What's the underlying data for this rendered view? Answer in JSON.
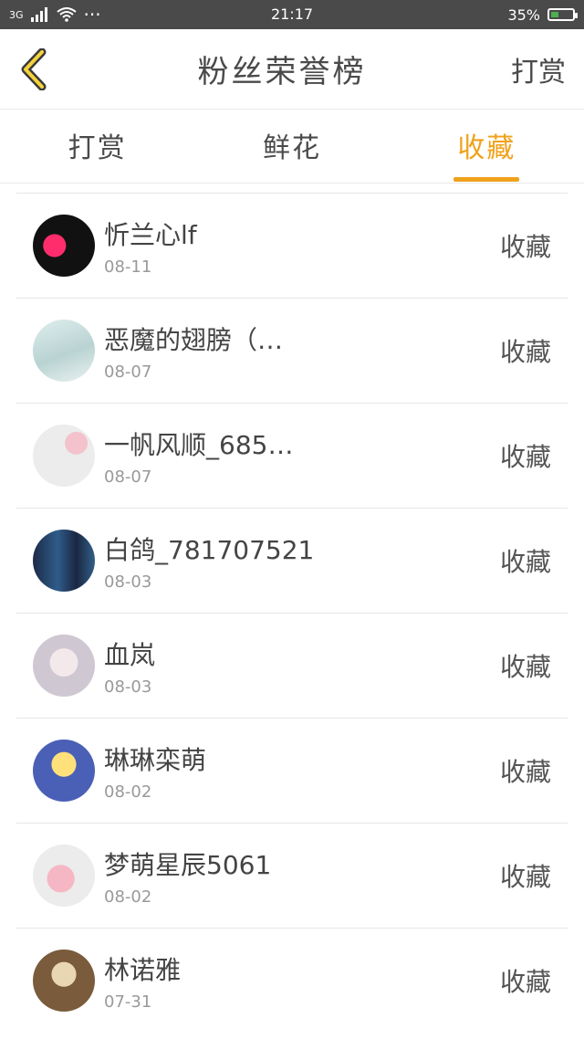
{
  "status_bar": {
    "network": "3G",
    "time": "21:17",
    "battery": "35%",
    "battery_level": 0.35,
    "dots": "···"
  },
  "header": {
    "title": "粉丝荣誉榜",
    "action": "打赏"
  },
  "tabs": [
    {
      "label": "打赏",
      "active": false
    },
    {
      "label": "鲜花",
      "active": false
    },
    {
      "label": "收藏",
      "active": true
    }
  ],
  "colors": {
    "accent": "#f0a21b",
    "status_bar": "#4a4a4a"
  },
  "list": [
    {
      "name": "忻兰心lf",
      "date": "08-11",
      "action": "收藏",
      "avatar": "heart-avatar"
    },
    {
      "name": "恶魔的翅膀（…",
      "date": "08-07",
      "action": "收藏",
      "avatar": "girl-white-avatar"
    },
    {
      "name": "一帆风顺_685…",
      "date": "08-07",
      "action": "收藏",
      "avatar": "plum-blossom-avatar"
    },
    {
      "name": "白鸽_781707521",
      "date": "08-03",
      "action": "收藏",
      "avatar": "group-photo-avatar"
    },
    {
      "name": "血岚",
      "date": "08-03",
      "action": "收藏",
      "avatar": "anime-girl-avatar"
    },
    {
      "name": "琳琳栾萌",
      "date": "08-02",
      "action": "收藏",
      "avatar": "fairy-avatar"
    },
    {
      "name": "梦萌星辰5061",
      "date": "08-02",
      "action": "收藏",
      "avatar": "pink-rabbit-avatar"
    },
    {
      "name": "林诺雅",
      "date": "07-31",
      "action": "收藏",
      "avatar": "lady-costume-avatar"
    }
  ]
}
